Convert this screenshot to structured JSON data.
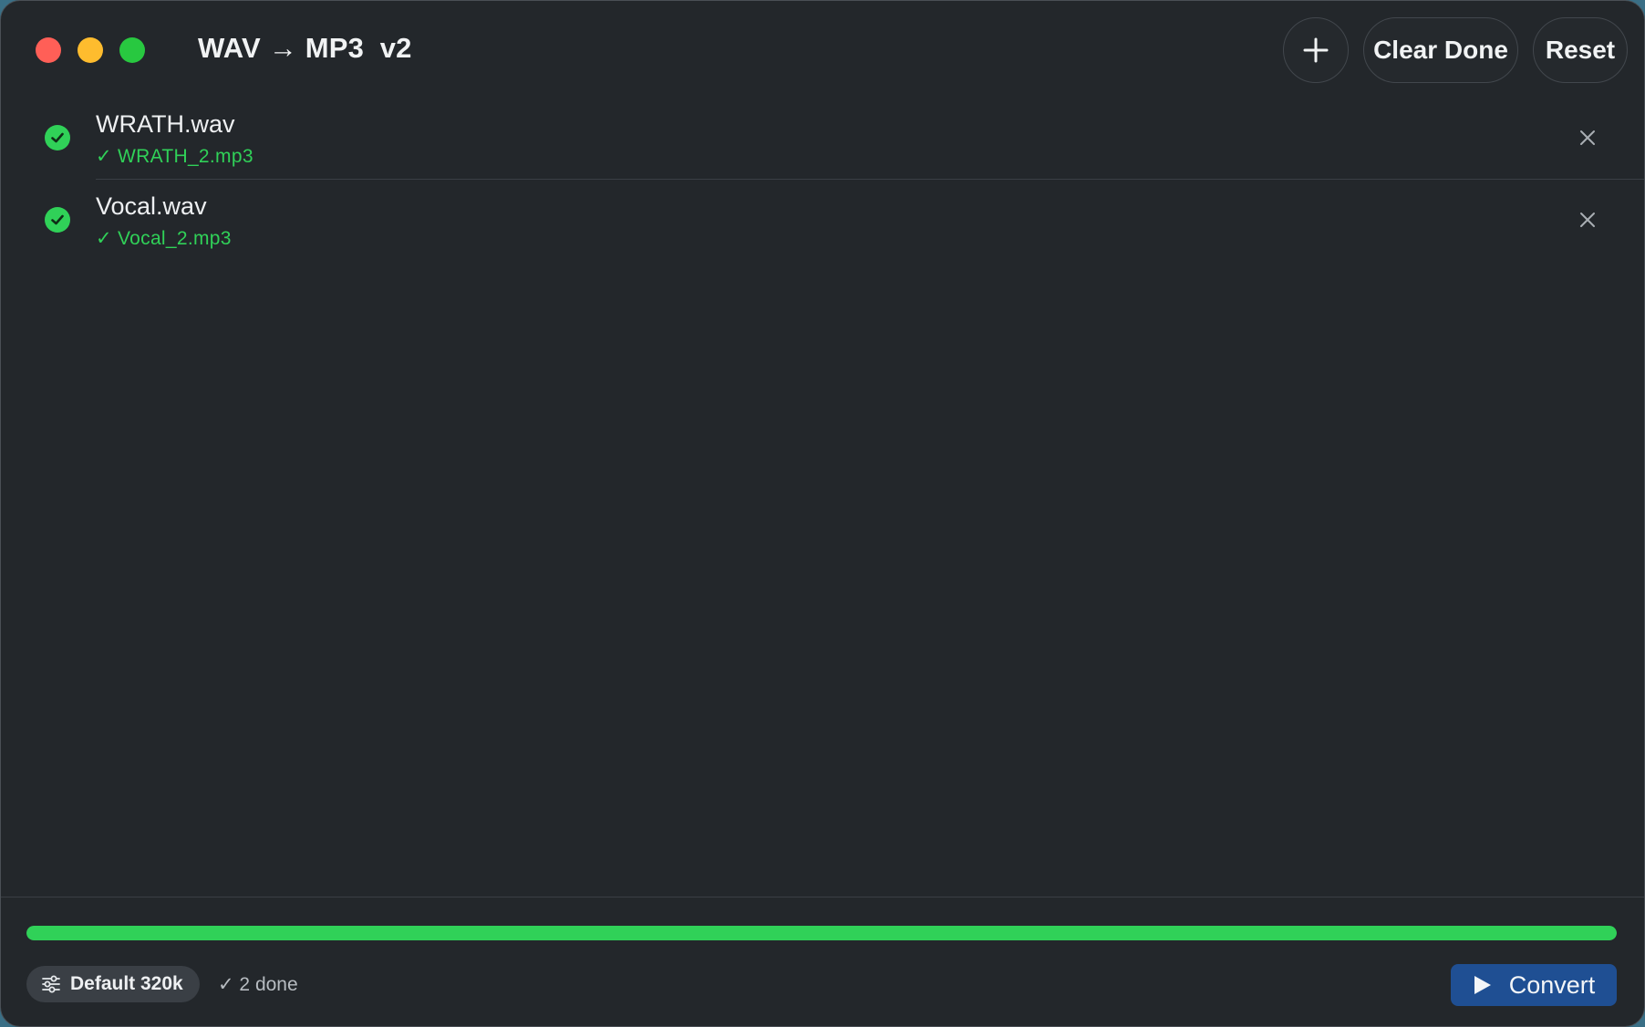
{
  "app": {
    "title": "WAV → MP3  v2"
  },
  "toolbar": {
    "add_icon": "plus-icon",
    "clear_done_label": "Clear Done",
    "reset_label": "Reset"
  },
  "files": [
    {
      "name": "WRATH.wav",
      "output": "✓ WRATH_2.mp3",
      "status": "done",
      "status_icon": "checkmark-circle-icon",
      "remove_icon": "close-icon"
    },
    {
      "name": "Vocal.wav",
      "output": "✓ Vocal_2.mp3",
      "status": "done",
      "status_icon": "checkmark-circle-icon",
      "remove_icon": "close-icon"
    }
  ],
  "footer": {
    "progress_percent": 100,
    "preset_label": "Default 320k",
    "preset_icon": "sliders-icon",
    "done_status": "✓ 2 done",
    "convert_label": "Convert",
    "convert_icon": "play-icon"
  },
  "colors": {
    "background": "#23272b",
    "success": "#30d158",
    "accent_button": "#1f4f93",
    "traffic_close": "#ff5f57",
    "traffic_minimize": "#febc2e",
    "traffic_maximize": "#28c840"
  }
}
